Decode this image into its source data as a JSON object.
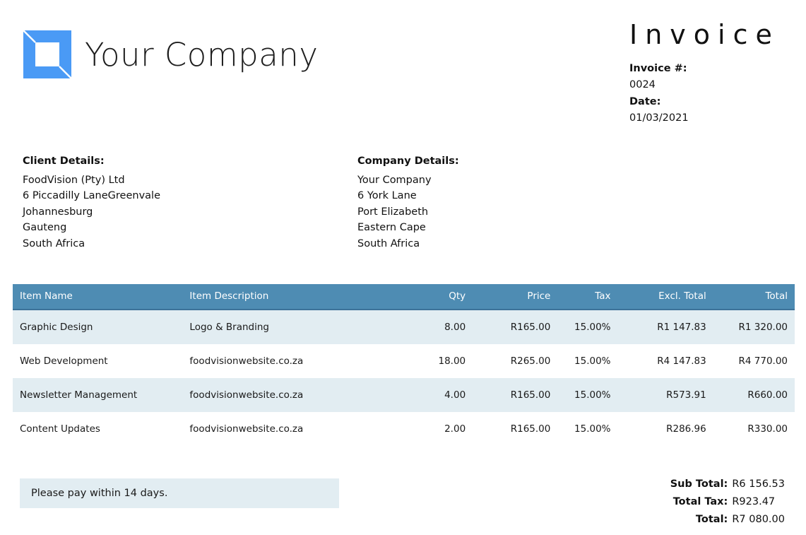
{
  "brand": {
    "company_name": "Your Company",
    "logo_color": "#4a9af5",
    "logo_icon": "square-diamond-logo-icon"
  },
  "header": {
    "title": "Invoice",
    "invoice_number_label": "Invoice #:",
    "invoice_number": "0024",
    "date_label": "Date:",
    "date": "01/03/2021"
  },
  "client": {
    "title": "Client Details:",
    "lines": [
      "FoodVision (Pty) Ltd",
      "6 Piccadilly LaneGreenvale",
      "Johannesburg",
      "Gauteng",
      "South Africa"
    ]
  },
  "company": {
    "title": "Company Details:",
    "lines": [
      "Your Company",
      "6 York Lane",
      "Port Elizabeth",
      "Eastern Cape",
      "South Africa"
    ]
  },
  "table": {
    "header_color": "#4e8cb3",
    "stripe_color": "#e2edf2",
    "columns": [
      "Item Name",
      "Item Description",
      "Qty",
      "Price",
      "Tax",
      "Excl. Total",
      "Total"
    ],
    "rows": [
      {
        "name": "Graphic Design",
        "description": "Logo & Branding",
        "qty": "8.00",
        "price": "R165.00",
        "tax": "15.00%",
        "excl_total": "R1 147.83",
        "total": "R1 320.00"
      },
      {
        "name": "Web Development",
        "description": "foodvisionwebsite.co.za",
        "qty": "18.00",
        "price": "R265.00",
        "tax": "15.00%",
        "excl_total": "R4 147.83",
        "total": "R4 770.00"
      },
      {
        "name": "Newsletter Management",
        "description": "foodvisionwebsite.co.za",
        "qty": "4.00",
        "price": "R165.00",
        "tax": "15.00%",
        "excl_total": "R573.91",
        "total": "R660.00"
      },
      {
        "name": "Content Updates",
        "description": "foodvisionwebsite.co.za",
        "qty": "2.00",
        "price": "R165.00",
        "tax": "15.00%",
        "excl_total": "R286.96",
        "total": "R330.00"
      }
    ]
  },
  "footer": {
    "note": "Please pay within 14 days.",
    "totals": [
      {
        "label": "Sub Total:",
        "value": "R6 156.53"
      },
      {
        "label": "Total Tax:",
        "value": "R923.47"
      },
      {
        "label": "Total:",
        "value": "R7 080.00"
      }
    ]
  }
}
